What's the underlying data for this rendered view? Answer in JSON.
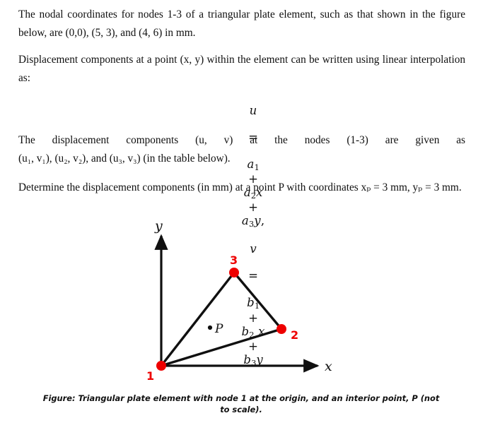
{
  "document": {
    "paragraph_1": "The nodal coordinates for nodes 1-3 of a triangular plate element, such as that shown in the figure below, are (0,0), (5, 3), and (4, 6) in mm.",
    "paragraph_2": "Displacement components at a point (x, y) within the element can be written using linear interpolation as:",
    "paragraph_3_line_1": "The displacement components (u,  v) at the nodes (1-3) are given as",
    "paragraph_3_line_2": "(u₁, v₁), (u₂, v₂), and (u₃, v₃) (in the table below).",
    "paragraph_4": "Determine the displacement components (in mm) at a point P with coordinates xₚ = 3 mm, yₚ = 3 mm.",
    "equation": {
      "u": "u = a₁ + a₂x + a₃y,",
      "v": "v = b₁ + b₂ x + b₃y",
      "u_parts": {
        "lhs": "u",
        "eq": "=",
        "t1": "a",
        "t1sub": "1",
        "t2": "a",
        "t2sub": "2",
        "t2var": "x",
        "t3": "a",
        "t3sub": "3",
        "t3var": "y",
        "trailing": ","
      },
      "v_parts": {
        "lhs": "v",
        "eq": "=",
        "t1": "b",
        "t1sub": "1",
        "t2": "b",
        "t2sub": "2",
        "t2var": "x",
        "t3": "b",
        "t3sub": "3",
        "t3var": "y"
      }
    },
    "given_point": {
      "label": "P",
      "x": "3 mm",
      "y": "3 mm"
    }
  },
  "figure": {
    "caption": "Figure: Triangular plate element with node 1 at the origin, and an interior point, P (not to scale).",
    "axis_x_label": "x",
    "axis_y_label": "y",
    "interior_point_label": "P",
    "node_labels": {
      "n1": "1",
      "n2": "2",
      "n3": "3"
    },
    "colors": {
      "node": "#ee0000",
      "line": "#101010",
      "label": "#ee0000"
    },
    "node_coordinates_mm": {
      "node1": [
        0,
        0
      ],
      "node2": [
        5,
        3
      ],
      "node3": [
        4,
        6
      ]
    }
  }
}
